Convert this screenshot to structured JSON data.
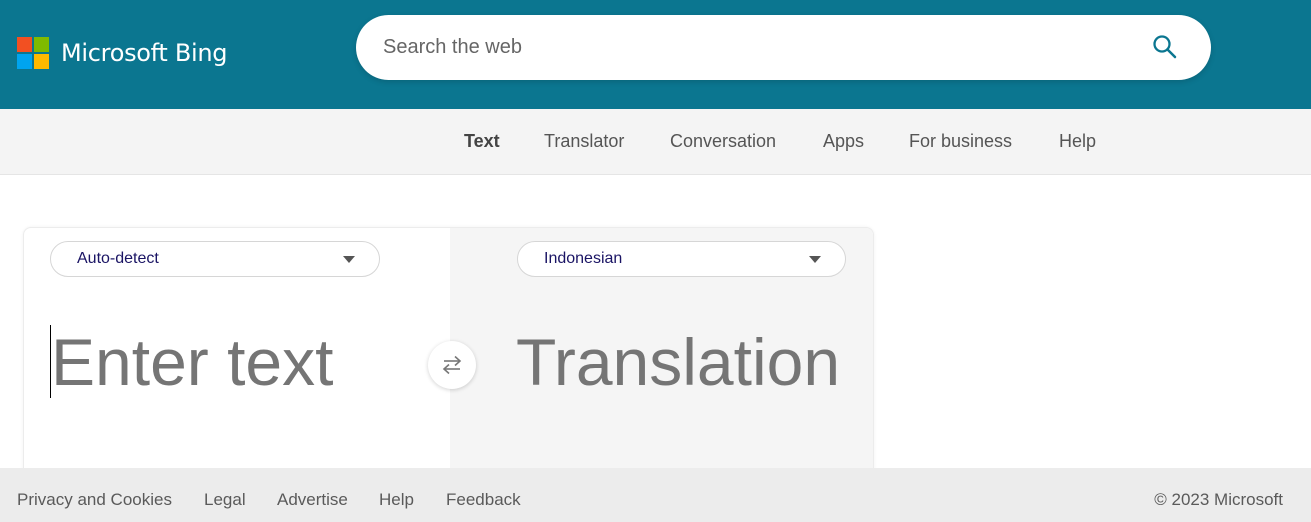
{
  "header": {
    "brand": "Microsoft Bing",
    "logo_colors": [
      "#f25022",
      "#7fba00",
      "#00a4ef",
      "#ffb900"
    ],
    "search": {
      "placeholder": "Search the web",
      "value": "",
      "icon": "search-icon"
    },
    "accent": "#0b7690"
  },
  "nav": {
    "items": [
      {
        "label": "Text",
        "active": true
      },
      {
        "label": "Translator"
      },
      {
        "label": "Conversation"
      },
      {
        "label": "Apps"
      },
      {
        "label": "For business"
      },
      {
        "label": "Help"
      }
    ]
  },
  "translator": {
    "source_language": "Auto-detect",
    "target_language": "Indonesian",
    "source_placeholder": "Enter text",
    "target_placeholder": "Translation",
    "swap_icon": "swap-arrows-icon"
  },
  "footer": {
    "links": [
      "Privacy and Cookies",
      "Legal",
      "Advertise",
      "Help",
      "Feedback"
    ],
    "copyright": "© 2023 Microsoft"
  }
}
